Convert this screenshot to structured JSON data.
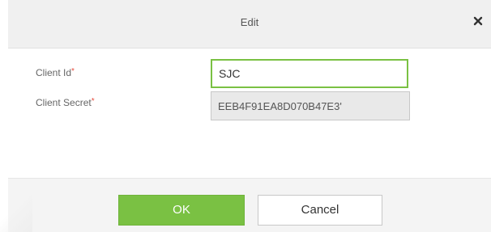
{
  "dialog": {
    "title": "Edit",
    "close_icon": "close-icon"
  },
  "form": {
    "client_id": {
      "label": "Client Id",
      "required_marker": "*",
      "value": "SJC"
    },
    "client_secret": {
      "label": "Client Secret",
      "required_marker": "*",
      "value": "EEB4F91EA8D070B47E3'"
    }
  },
  "buttons": {
    "ok_label": "OK",
    "cancel_label": "Cancel"
  },
  "colors": {
    "accent": "#7ac143",
    "required": "#e64b3c"
  }
}
